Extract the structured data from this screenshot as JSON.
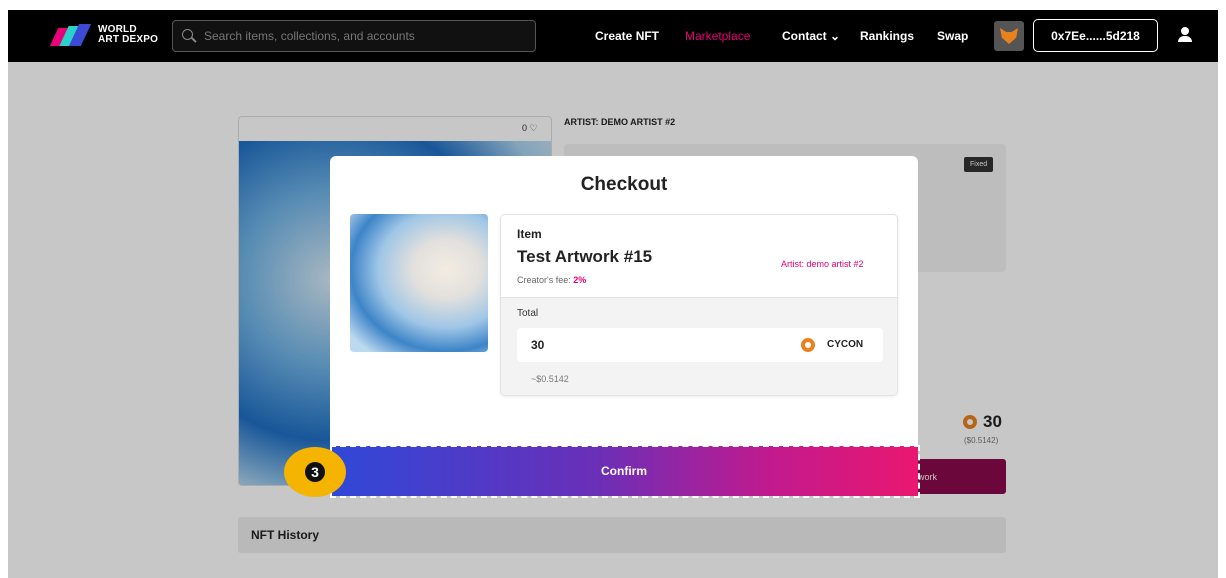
{
  "nav": {
    "logo_line1": "WORLD",
    "logo_line2": "ART DEXPO",
    "search_placeholder": "Search items, collections, and accounts",
    "links": [
      "Create NFT",
      "Marketplace",
      "Contact ⌄",
      "Rankings",
      "Swap"
    ],
    "active_link": "Marketplace",
    "wallet_address": "0x7Ee......5d218"
  },
  "page": {
    "likes": "0 ♡",
    "artist_heading": "ARTIST: DEMO ARTIST #2",
    "sale_type": "Fixed",
    "price": "30",
    "price_usd": "($0.5142)",
    "buy_button_partial": "work",
    "history_label": "NFT History"
  },
  "checkout": {
    "title": "Checkout",
    "item_label": "Item",
    "item_name": "Test Artwork #15",
    "artist": "Artist: demo artist #2",
    "creator_fee_label": "Creator's fee: ",
    "creator_fee_value": "2%",
    "total_label": "Total",
    "total_amount": "30",
    "currency": "CYCON",
    "usd_estimate": "~$0.5142",
    "confirm_label": "Confirm"
  },
  "annotation": {
    "step_number": "3"
  },
  "colors": {
    "accent": "#e6007a",
    "confirm_gradient_start": "#2f48d8",
    "confirm_gradient_end": "#ea1770",
    "step_badge": "#f5b400"
  }
}
